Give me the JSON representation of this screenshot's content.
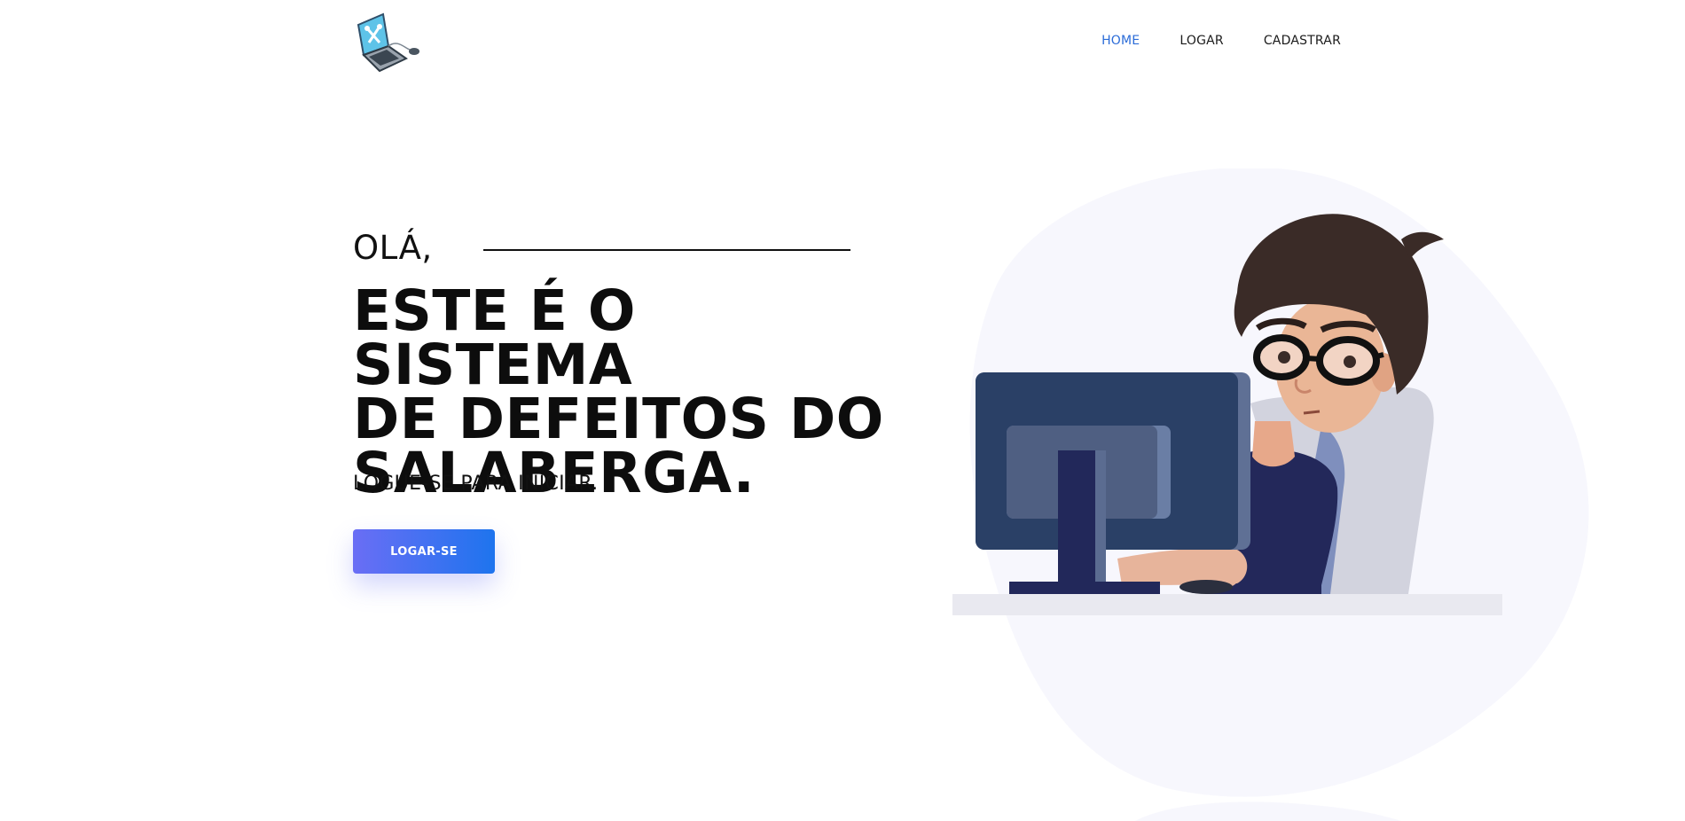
{
  "header": {
    "logo_icon": "laptop-tools-logo-icon",
    "nav": [
      {
        "label": "HOME",
        "active": true
      },
      {
        "label": "LOGAR",
        "active": false
      },
      {
        "label": "CADASTRAR",
        "active": false
      }
    ]
  },
  "hero": {
    "greeting": "OLÁ,",
    "headline_lines": [
      "ESTE É O SISTEMA",
      "DE DEFEITOS DO",
      "SALABERGA."
    ],
    "subline": "LOGUE-SE PARA INICIAR.",
    "cta_label": "LOGAR-SE",
    "illustration_icon": "developer-at-computer-illustration"
  },
  "colors": {
    "accent": "#2b6cd8",
    "button_gradient_start": "#6a6ef5",
    "button_gradient_end": "#1e74ee",
    "blob": "#f7f7fd",
    "monitor": "#2a4066"
  }
}
